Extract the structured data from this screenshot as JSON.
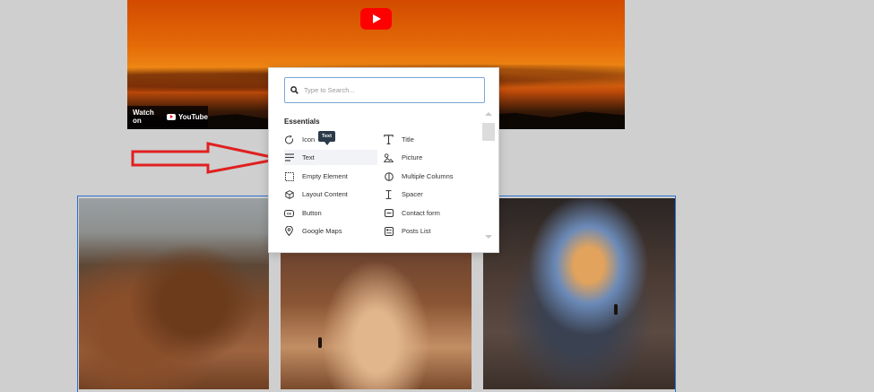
{
  "video": {
    "watch_on_label": "Watch on",
    "youtube_label": "YouTube"
  },
  "tooltip": {
    "text": "Text"
  },
  "popup": {
    "search_placeholder": "Type to Search...",
    "section_title": "Essentials",
    "items_left": [
      {
        "label": "Icon",
        "icon": "circle-arrow-icon"
      },
      {
        "label": "Text",
        "icon": "lines-icon"
      },
      {
        "label": "Empty Element",
        "icon": "dotted-square-icon"
      },
      {
        "label": "Layout Content",
        "icon": "cube-icon"
      },
      {
        "label": "Button",
        "icon": "button-icon"
      },
      {
        "label": "Google Maps",
        "icon": "map-pin-icon"
      }
    ],
    "items_right": [
      {
        "label": "Title",
        "icon": "title-t-icon"
      },
      {
        "label": "Picture",
        "icon": "picture-icon"
      },
      {
        "label": "Multiple Columns",
        "icon": "columns-icon"
      },
      {
        "label": "Spacer",
        "icon": "spacer-icon"
      },
      {
        "label": "Contact form",
        "icon": "form-icon"
      },
      {
        "label": "Posts List",
        "icon": "posts-icon"
      }
    ]
  },
  "colors": {
    "arrow": "#e02020",
    "selection_border": "#2b6fd0",
    "youtube_red": "#ff0000"
  }
}
